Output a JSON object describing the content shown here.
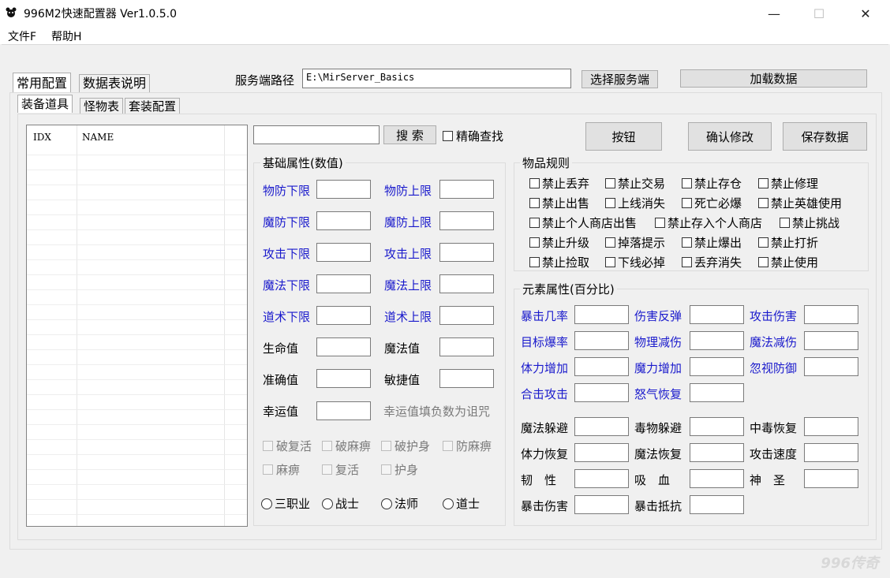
{
  "window": {
    "title": "996M2快速配置器 Ver1.0.5.0",
    "minimize": "—",
    "maximize": "☐",
    "close": "✕"
  },
  "menu": [
    "文件F",
    "帮助H"
  ],
  "top_tabs": [
    "常用配置",
    "数据表说明"
  ],
  "server": {
    "label": "服务端路径",
    "path": "E:\\MirServer_Basics",
    "select_button": "选择服务端",
    "load_button": "加载数据"
  },
  "sub_tabs": [
    "装备道具",
    "怪物表",
    "套装配置"
  ],
  "table": {
    "columns": [
      "IDX",
      "NAME"
    ]
  },
  "search": {
    "value": "",
    "button": "搜 索",
    "exact_label": "精确查找"
  },
  "actions": [
    "按钮",
    "确认修改",
    "保存数据"
  ],
  "basic_attrs": {
    "title": "基础属性(数值)",
    "rows": [
      [
        "物防下限",
        "物防上限"
      ],
      [
        "魔防下限",
        "魔防上限"
      ],
      [
        "攻击下限",
        "攻击上限"
      ],
      [
        "魔法下限",
        "魔法上限"
      ],
      [
        "道术下限",
        "道术上限"
      ],
      [
        "生命值",
        "魔法值"
      ],
      [
        "准确值",
        "敏捷值"
      ]
    ],
    "luck_label": "幸运值",
    "luck_hint": "幸运值填负数为诅咒",
    "disabled_checks": [
      [
        "破复活",
        "破麻痹",
        "破护身",
        "防麻痹"
      ],
      [
        "麻痹",
        "复活",
        "护身"
      ]
    ],
    "jobs": [
      "三职业",
      "战士",
      "法师",
      "道士"
    ]
  },
  "item_rules": {
    "title": "物品规则",
    "rows": [
      [
        "禁止丢弃",
        "禁止交易",
        "禁止存仓",
        "禁止修理"
      ],
      [
        "禁止出售",
        "上线消失",
        "死亡必爆",
        "禁止英雄使用"
      ],
      [
        "禁止个人商店出售",
        "禁止存入个人商店",
        "禁止挑战"
      ],
      [
        "禁止升级",
        "掉落提示",
        "禁止爆出",
        "禁止打折"
      ],
      [
        "禁止捡取",
        "下线必掉",
        "丢弃消失",
        "禁止使用"
      ]
    ]
  },
  "element_attrs": {
    "title": "元素属性(百分比)",
    "blue_rows": [
      [
        "暴击几率",
        "伤害反弹",
        "攻击伤害"
      ],
      [
        "目标爆率",
        "物理减伤",
        "魔法减伤"
      ],
      [
        "体力增加",
        "魔力增加",
        "忽视防御"
      ],
      [
        "合击攻击",
        "怒气恢复"
      ]
    ],
    "black_rows": [
      [
        "魔法躲避",
        "毒物躲避",
        "中毒恢复"
      ],
      [
        "体力恢复",
        "魔法恢复",
        "攻击速度"
      ],
      [
        "韧　性",
        "吸　血",
        "神　圣"
      ],
      [
        "暴击伤害",
        "暴击抵抗"
      ]
    ]
  },
  "watermark": "996传奇"
}
